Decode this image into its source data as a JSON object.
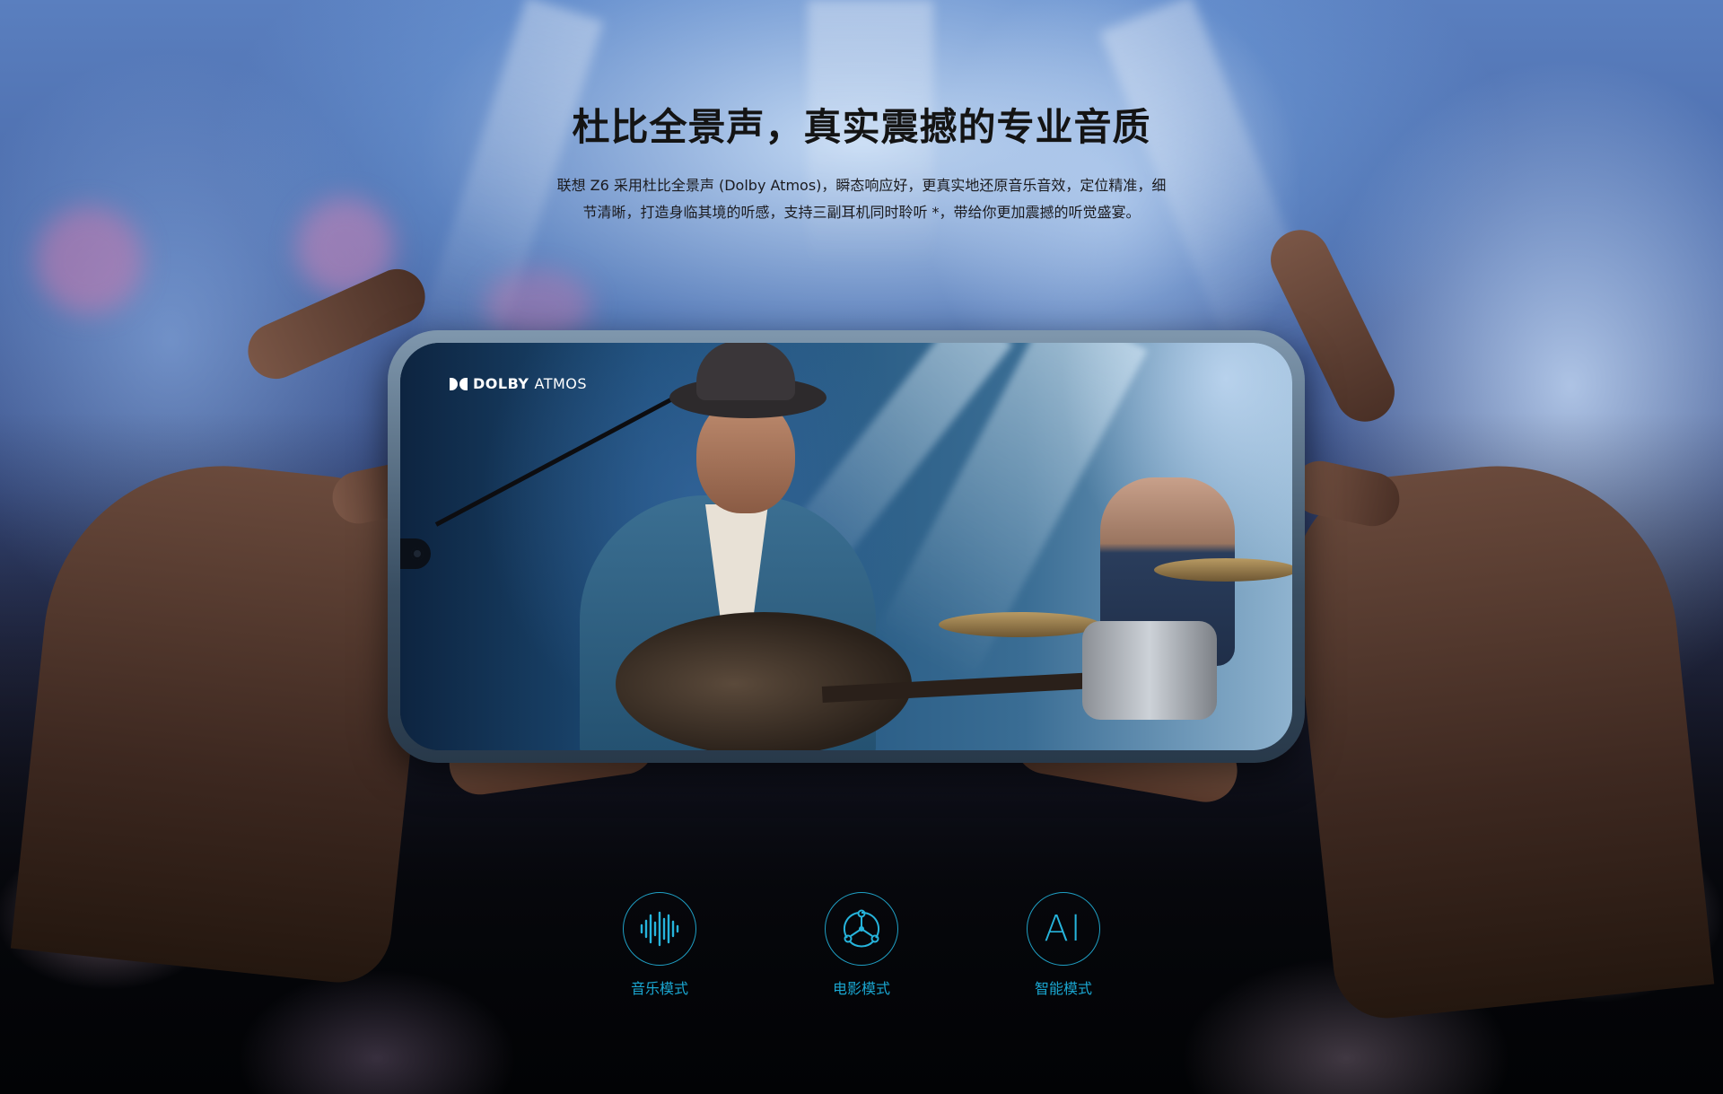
{
  "section": {
    "title": "杜比全景声，真实震撼的专业音质",
    "description_line1": "联想 Z6 采用杜比全景声 (Dolby Atmos)，瞬态响应好，更真实地还原音乐音效，定位精准，细",
    "description_line2": "节清晰，打造身临其境的听感，支持三副耳机同时聆听 *，带给你更加震撼的听觉盛宴。"
  },
  "phone": {
    "badge_brand": "DOLBY",
    "badge_product": "ATMOS"
  },
  "modes": [
    {
      "label": "音乐模式",
      "icon": "sound-wave-icon"
    },
    {
      "label": "电影模式",
      "icon": "cinema-nodes-icon"
    },
    {
      "label": "智能模式",
      "icon": "ai-icon",
      "glyph": "AI"
    }
  ],
  "colors": {
    "accent": "#1aa6d0",
    "headline": "#141414"
  }
}
